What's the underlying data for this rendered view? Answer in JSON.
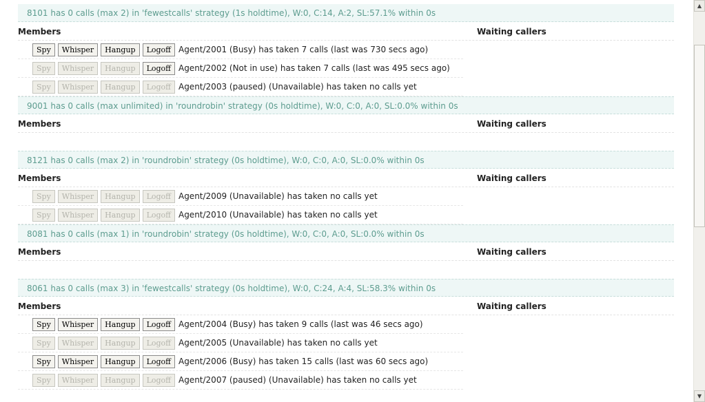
{
  "labels": {
    "members": "Members",
    "waiting": "Waiting callers"
  },
  "buttons": {
    "spy": "Spy",
    "whisper": "Whisper",
    "hangup": "Hangup",
    "logoff": "Logoff"
  },
  "queues": [
    {
      "header": "8101 has 0 calls (max 2) in 'fewestcalls' strategy (1s holdtime), W:0, C:14, A:2, SL:57.1% within 0s",
      "members": [
        {
          "text": "Agent/2001 (Busy) has taken 7 calls (last was 730 secs ago)",
          "spy": true,
          "whisper": true,
          "hangup": true,
          "logoff": true
        },
        {
          "text": "Agent/2002 (Not in use) has taken 7 calls (last was 495 secs ago)",
          "spy": false,
          "whisper": false,
          "hangup": false,
          "logoff": true
        },
        {
          "text": "Agent/2003 (paused) (Unavailable) has taken no calls yet",
          "spy": false,
          "whisper": false,
          "hangup": false,
          "logoff": false
        }
      ]
    },
    {
      "header": "9001 has 0 calls (max unlimited) in 'roundrobin' strategy (0s holdtime), W:0, C:0, A:0, SL:0.0% within 0s",
      "members": []
    },
    {
      "header": "8121 has 0 calls (max 2) in 'roundrobin' strategy (0s holdtime), W:0, C:0, A:0, SL:0.0% within 0s",
      "members": [
        {
          "text": "Agent/2009 (Unavailable) has taken no calls yet",
          "spy": false,
          "whisper": false,
          "hangup": false,
          "logoff": false
        },
        {
          "text": "Agent/2010 (Unavailable) has taken no calls yet",
          "spy": false,
          "whisper": false,
          "hangup": false,
          "logoff": false
        }
      ]
    },
    {
      "header": "8081 has 0 calls (max 1) in 'roundrobin' strategy (0s holdtime), W:0, C:0, A:0, SL:0.0% within 0s",
      "members": []
    },
    {
      "header": "8061 has 0 calls (max 3) in 'fewestcalls' strategy (0s holdtime), W:0, C:24, A:4, SL:58.3% within 0s",
      "members": [
        {
          "text": "Agent/2004 (Busy) has taken 9 calls (last was 46 secs ago)",
          "spy": true,
          "whisper": true,
          "hangup": true,
          "logoff": true
        },
        {
          "text": "Agent/2005 (Unavailable) has taken no calls yet",
          "spy": false,
          "whisper": false,
          "hangup": false,
          "logoff": false
        },
        {
          "text": "Agent/2006 (Busy) has taken 15 calls (last was 60 secs ago)",
          "spy": true,
          "whisper": true,
          "hangup": true,
          "logoff": true
        },
        {
          "text": "Agent/2007 (paused) (Unavailable) has taken no calls yet",
          "spy": false,
          "whisper": false,
          "hangup": false,
          "logoff": false
        }
      ]
    }
  ],
  "scrollbar": {
    "up_icon": "arrow-up-icon",
    "down_icon": "arrow-down-icon",
    "up_glyph": "▲",
    "down_glyph": "▼",
    "position": 0.17
  },
  "colors": {
    "header_bg": "#eef7f6",
    "header_text": "#5d9c8f"
  }
}
